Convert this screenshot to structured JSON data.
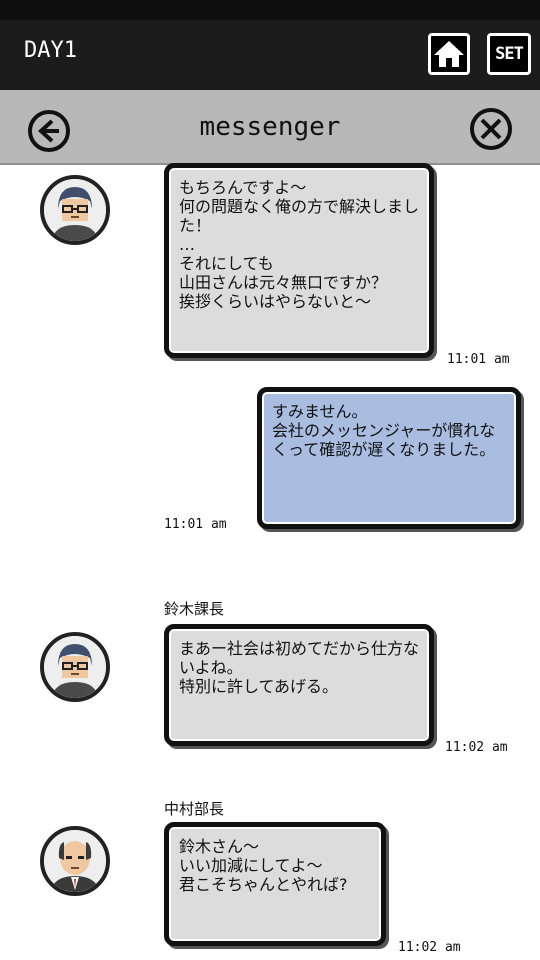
{
  "header": {
    "day": "DAY1",
    "home_icon": "home-icon",
    "set_label": "SET"
  },
  "nav": {
    "title": "messenger",
    "back_icon": "back-arrow-icon",
    "close_icon": "close-icon"
  },
  "colors": {
    "topbar": "#1c1c1c",
    "navbar": "#b8b8b8",
    "incoming_bubble": "#dcdcdc",
    "outgoing_bubble": "#a9bde0"
  },
  "messages": [
    {
      "direction": "incoming",
      "sender": "",
      "avatar": "glasses-man-avatar",
      "text": "もちろんですよ～\n何の問題なく俺の方で解決しました！\n…\nそれにしても\n山田さんは元々無口ですか？\n挨拶くらいはやらないと～",
      "time": "11:01 am"
    },
    {
      "direction": "outgoing",
      "sender": "",
      "text": "すみません。\n会社のメッセンジャーが慣れなくって確認が遅くなりました。",
      "time": "11:01 am"
    },
    {
      "direction": "incoming",
      "sender": "鈴木課長",
      "avatar": "glasses-man-avatar",
      "text": "まあー社会は初めてだから仕方ないよね。\n特別に許してあげる。",
      "time": "11:02 am"
    },
    {
      "direction": "incoming",
      "sender": "中村部長",
      "avatar": "bald-man-avatar",
      "text": "鈴木さん～\nいい加減にしてよ～\n君こそちゃんとやれば?",
      "time": "11:02 am"
    }
  ]
}
